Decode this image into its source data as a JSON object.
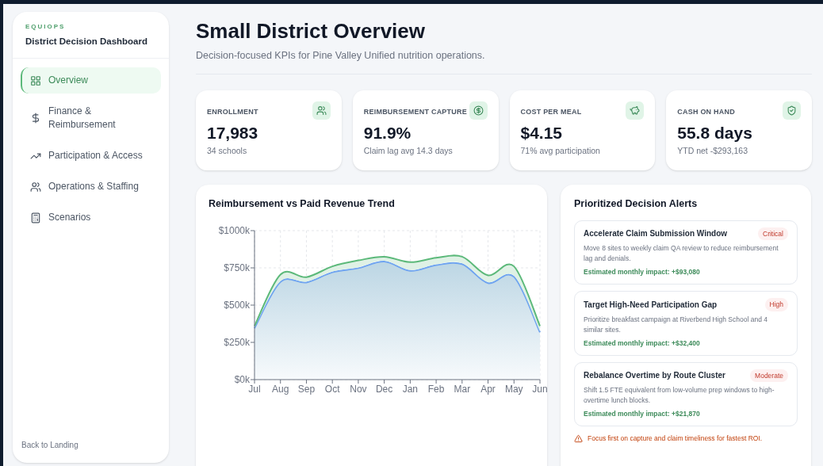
{
  "sidebar": {
    "brand": "EQUIOPS",
    "title": "District Decision Dashboard",
    "items": [
      {
        "label": "Overview",
        "selected": true
      },
      {
        "label": "Finance & Reimbursement",
        "selected": false
      },
      {
        "label": "Participation & Access",
        "selected": false
      },
      {
        "label": "Operations & Staffing",
        "selected": false
      },
      {
        "label": "Scenarios",
        "selected": false
      }
    ],
    "footer_link": "Back to Landing"
  },
  "header": {
    "title": "Small District Overview",
    "subtitle": "Decision-focused KPIs for Pine Valley Unified nutrition operations."
  },
  "kpis": [
    {
      "label": "ENROLLMENT",
      "value": "17,983",
      "note": "34 schools"
    },
    {
      "label": "REIMBURSEMENT CAPTURE",
      "value": "91.9%",
      "note": "Claim lag avg 14.3 days"
    },
    {
      "label": "COST PER MEAL",
      "value": "$4.15",
      "note": "71% avg participation"
    },
    {
      "label": "CASH ON HAND",
      "value": "55.8 days",
      "note": "YTD net -$293,163"
    }
  ],
  "trend": {
    "title": "Reimbursement vs Paid Revenue Trend",
    "chart_data": {
      "type": "area",
      "categories": [
        "Jul",
        "Aug",
        "Sep",
        "Oct",
        "Nov",
        "Dec",
        "Jan",
        "Feb",
        "Mar",
        "Apr",
        "May",
        "Jun"
      ],
      "series": [
        {
          "color": "#5cb97a",
          "values": [
            360,
            705,
            688,
            760,
            800,
            825,
            788,
            818,
            825,
            700,
            760,
            360
          ]
        },
        {
          "color": "#6fa4f0",
          "values": [
            345,
            655,
            652,
            720,
            748,
            792,
            730,
            768,
            775,
            648,
            690,
            318
          ]
        }
      ],
      "grid": true,
      "ylim": [
        0,
        1000
      ],
      "yticks": [
        {
          "value": 0,
          "label": "$0k"
        },
        {
          "value": 250,
          "label": "$250k"
        },
        {
          "value": 500,
          "label": "$500k"
        },
        {
          "value": 750,
          "label": "$750k"
        },
        {
          "value": 1000,
          "label": "$1000k"
        }
      ]
    }
  },
  "alerts": {
    "title": "Prioritized Decision Alerts",
    "items": [
      {
        "title": "Accelerate Claim Submission Window",
        "badge": "Critical",
        "body": "Move 8 sites to weekly claim QA review to reduce reimbursement lag and denials.",
        "impact": "Estimated monthly impact: +$93,080"
      },
      {
        "title": "Target High-Need Participation Gap",
        "badge": "High",
        "body": "Prioritize breakfast campaign at Riverbend High School and 4 similar sites.",
        "impact": "Estimated monthly impact: +$32,400"
      },
      {
        "title": "Rebalance Overtime by Route Cluster",
        "badge": "Moderate",
        "body": "Shift 1.5 FTE equivalent from low-volume prep windows to high-overtime lunch blocks.",
        "impact": "Estimated monthly impact: +$21,870"
      }
    ],
    "note": "Focus first on capture and claim timeliness for fastest ROI."
  }
}
